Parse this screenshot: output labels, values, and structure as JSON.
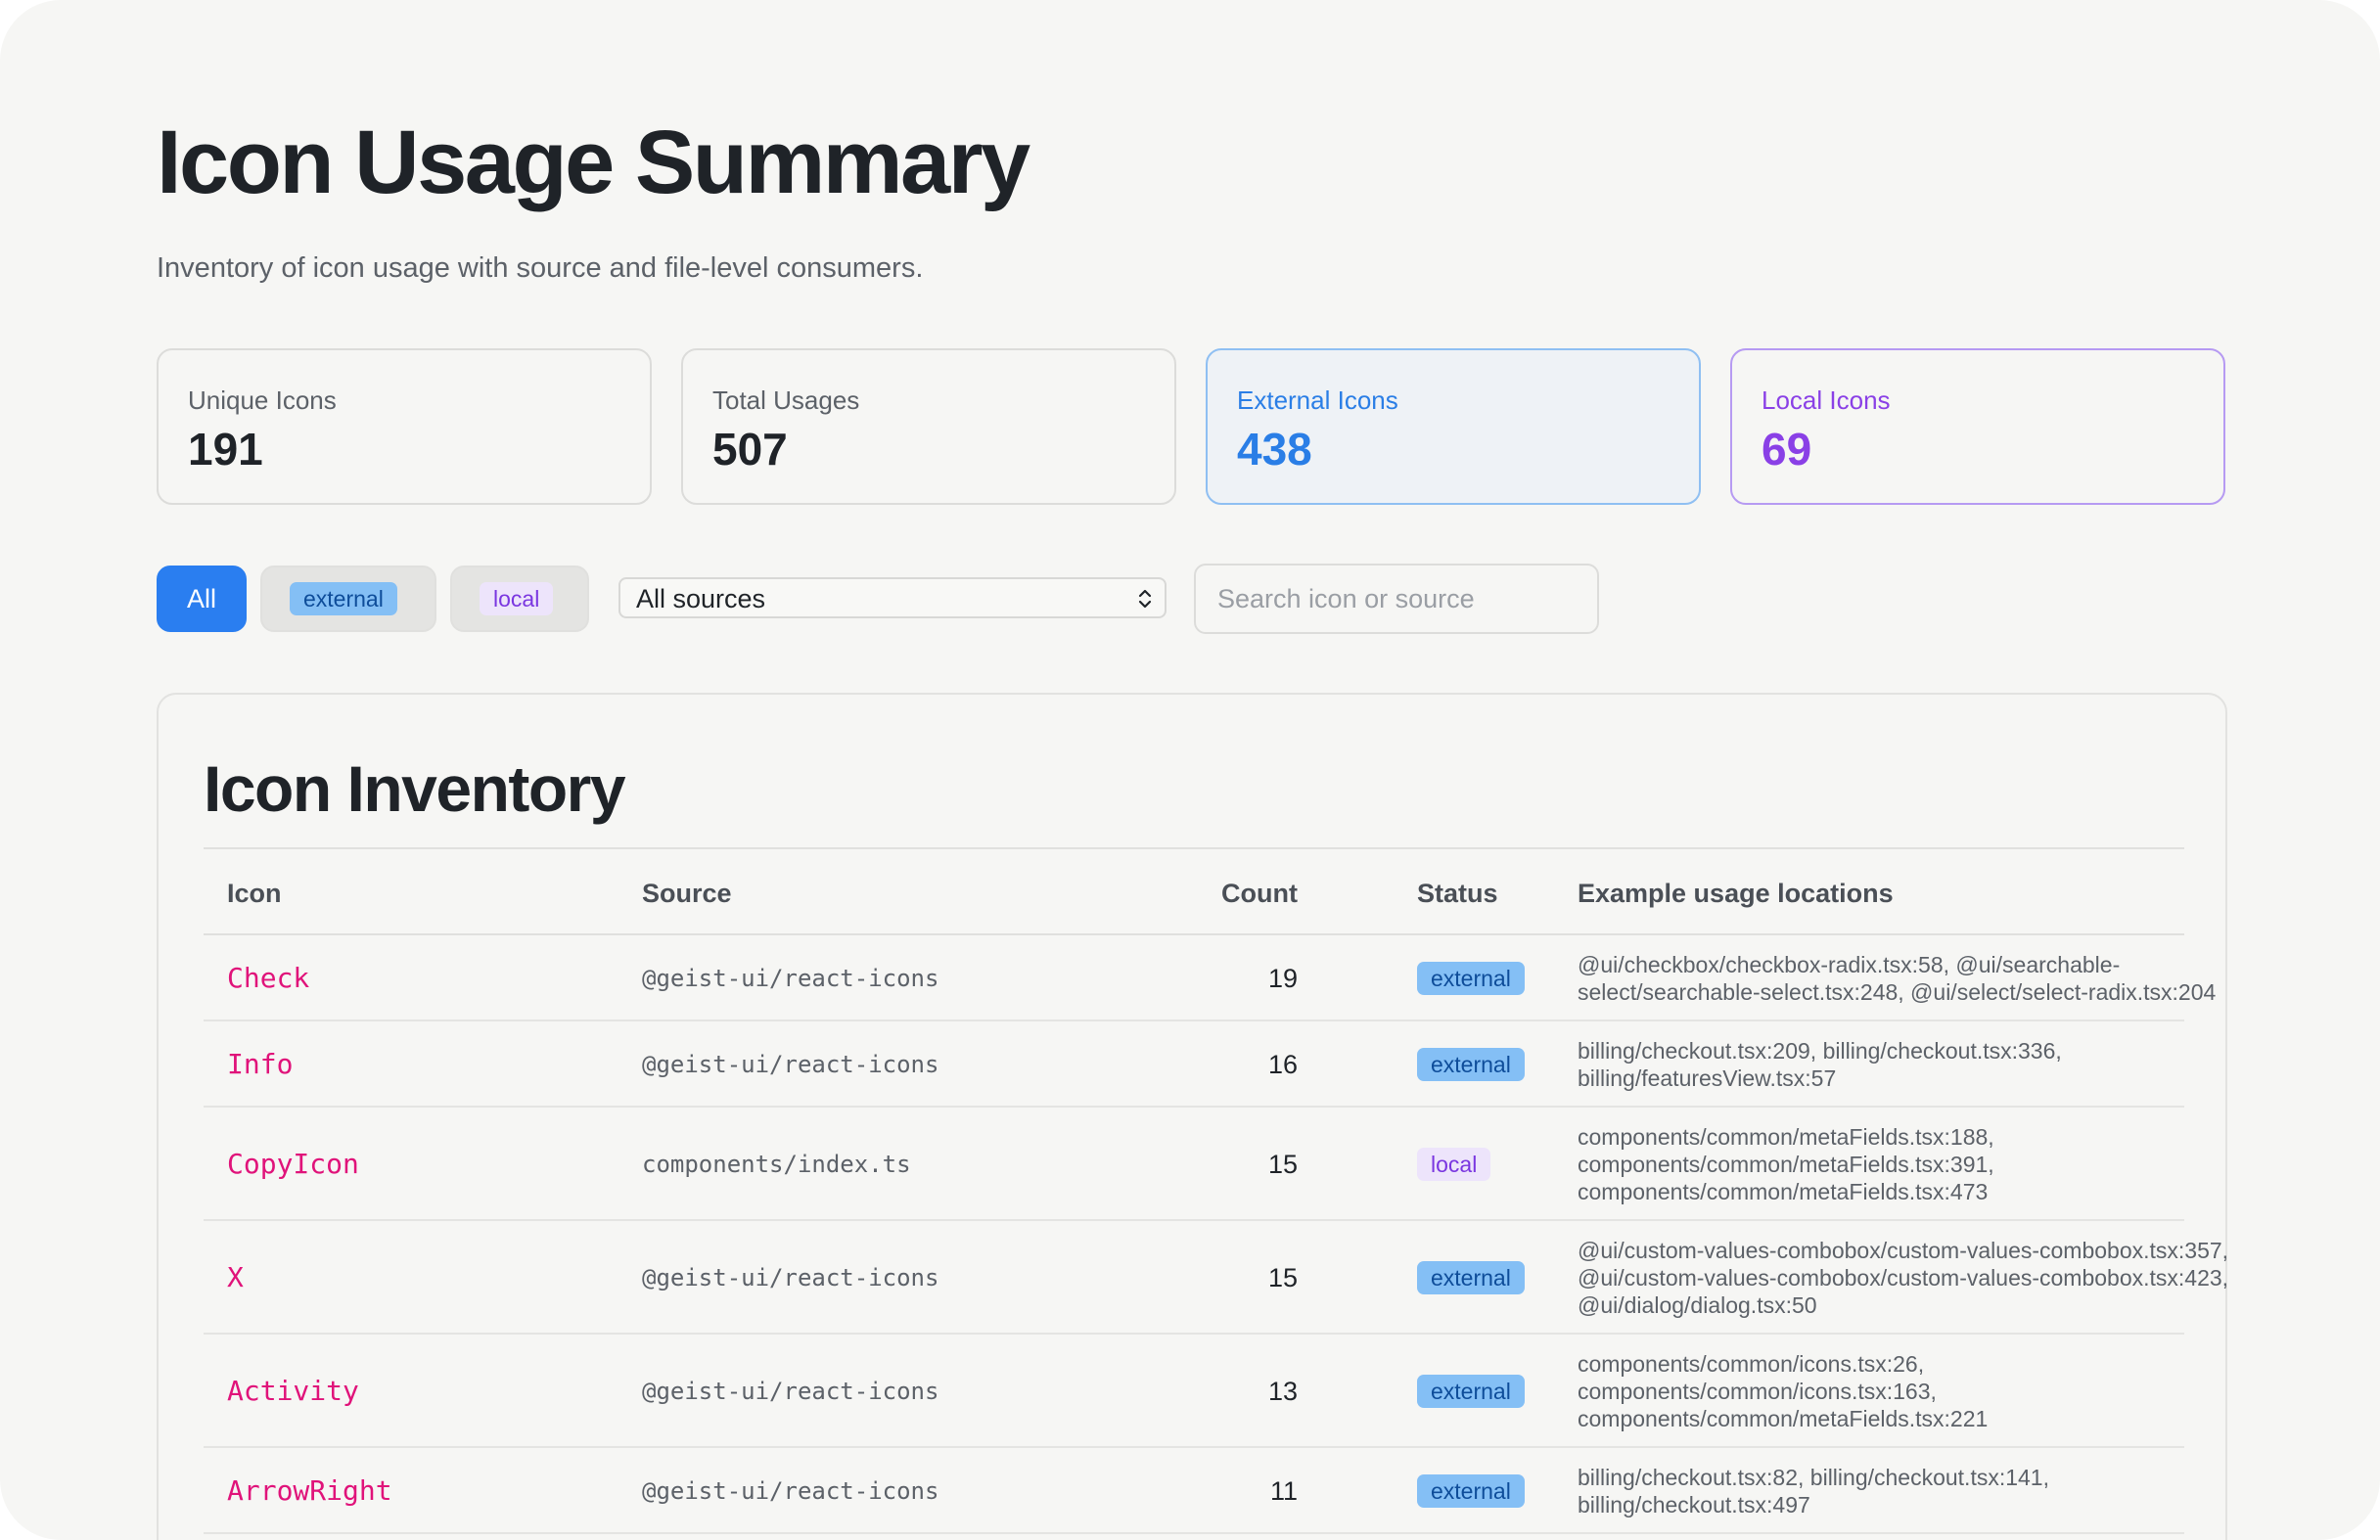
{
  "page": {
    "title": "Icon Usage Summary",
    "subtitle": "Inventory of icon usage with source and file-level consumers."
  },
  "stats": [
    {
      "label": "Unique Icons",
      "value": "191"
    },
    {
      "label": "Total Usages",
      "value": "507"
    },
    {
      "label": "External Icons",
      "value": "438",
      "accent": "#2a7ee6"
    },
    {
      "label": "Local Icons",
      "value": "69",
      "accent": "#8a40e6"
    }
  ],
  "filters": {
    "all_label": "All",
    "external_label": "external",
    "local_label": "local",
    "active": "All",
    "source_select": {
      "value": "All sources",
      "icon": "chevron-up-down-icon"
    },
    "search_placeholder": "Search icon or source"
  },
  "inventory": {
    "title": "Icon Inventory",
    "columns": [
      "Icon",
      "Source",
      "Count",
      "Status",
      "Example usage locations"
    ],
    "rows": [
      {
        "icon": "Check",
        "source": "@geist-ui/react-icons",
        "count": "19",
        "status": "external",
        "usage": [
          "@ui/checkbox/checkbox-radix.tsx:58, @ui/searchable-",
          "select/searchable-select.tsx:248, @ui/select/select-radix.tsx:204"
        ]
      },
      {
        "icon": "Info",
        "source": "@geist-ui/react-icons",
        "count": "16",
        "status": "external",
        "usage": [
          "billing/checkout.tsx:209, billing/checkout.tsx:336,",
          "billing/featuresView.tsx:57"
        ]
      },
      {
        "icon": "CopyIcon",
        "source": "components/index.ts",
        "count": "15",
        "status": "local",
        "usage": [
          "components/common/metaFields.tsx:188,",
          "components/common/metaFields.tsx:391,",
          "components/common/metaFields.tsx:473"
        ]
      },
      {
        "icon": "X",
        "source": "@geist-ui/react-icons",
        "count": "15",
        "status": "external",
        "usage": [
          "@ui/custom-values-combobox/custom-values-combobox.tsx:357,",
          "@ui/custom-values-combobox/custom-values-combobox.tsx:423,",
          "@ui/dialog/dialog.tsx:50"
        ]
      },
      {
        "icon": "Activity",
        "source": "@geist-ui/react-icons",
        "count": "13",
        "status": "external",
        "usage": [
          "components/common/icons.tsx:26,",
          "components/common/icons.tsx:163,",
          "components/common/metaFields.tsx:221"
        ]
      },
      {
        "icon": "ArrowRight",
        "source": "@geist-ui/react-icons",
        "count": "11",
        "status": "external",
        "usage": [
          "billing/checkout.tsx:82, billing/checkout.tsx:141,",
          "billing/checkout.tsx:497"
        ]
      }
    ]
  },
  "colors": {
    "primary": "#2a7ef0",
    "external_badge_bg": "#84bff5",
    "local_badge_bg": "#ede4fb",
    "icon_name": "#e0137a"
  }
}
